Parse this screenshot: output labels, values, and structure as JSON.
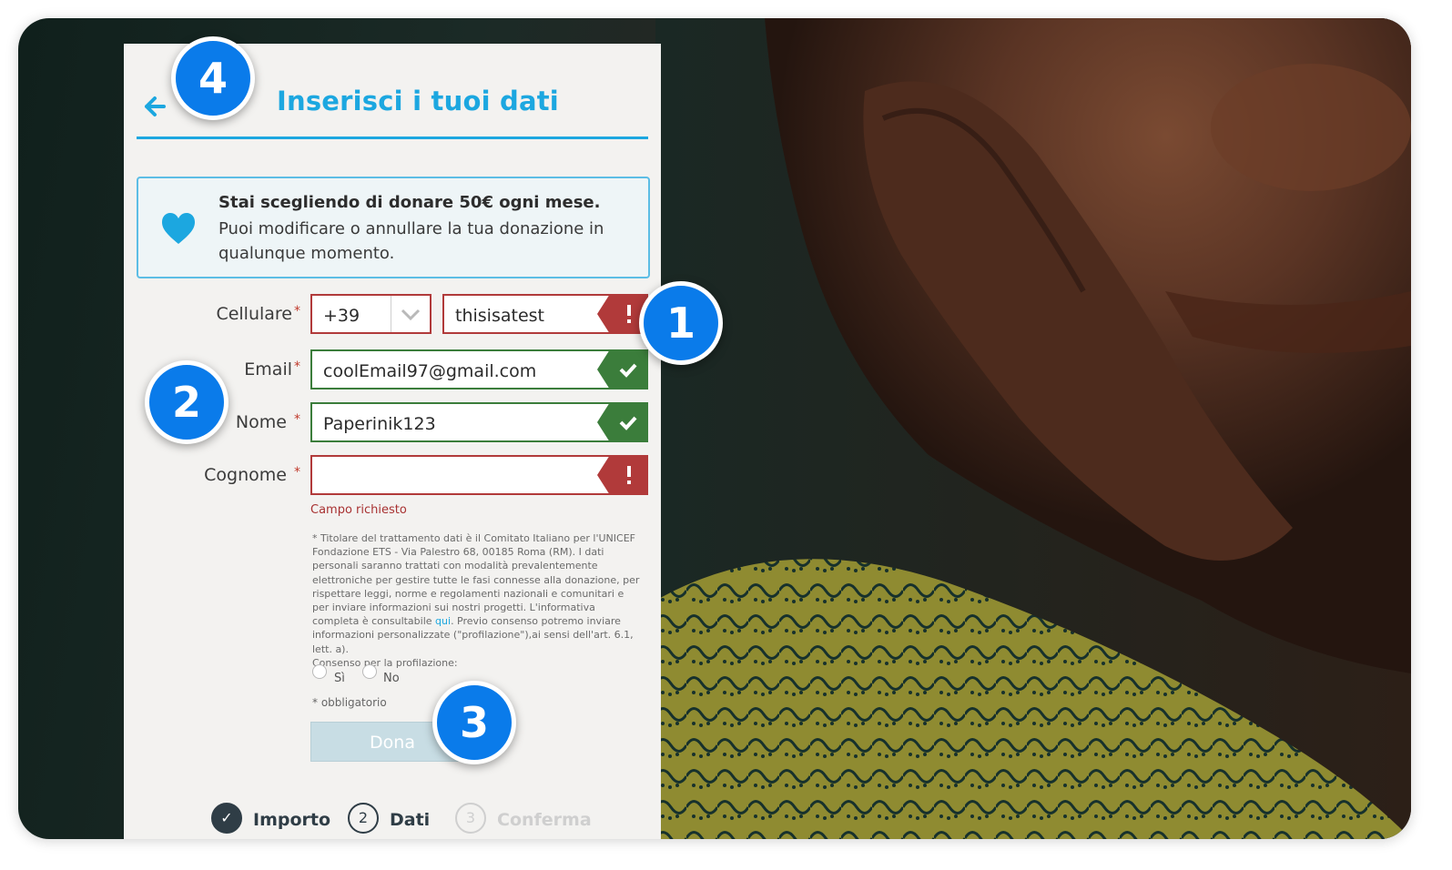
{
  "header": {
    "title": "Inserisci i tuoi dati"
  },
  "info": {
    "bold": "Stai scegliendo di donare 50€ ogni mese.",
    "text": "Puoi modificare o annullare la tua donazione in qualunque momento."
  },
  "form": {
    "cellulare": {
      "label": "Cellulare",
      "prefix": "+39",
      "value": "thisisatest",
      "status": "error"
    },
    "email": {
      "label": "Email",
      "value": "coolEmail97@gmail.com",
      "status": "valid"
    },
    "nome": {
      "label": "Nome",
      "value": "Paperinik123",
      "status": "valid"
    },
    "cognome": {
      "label": "Cognome",
      "value": "",
      "status": "error",
      "error": "Campo richiesto"
    },
    "required_mark": "*"
  },
  "legal": {
    "text_before_link": "* Titolare del trattamento dati è il Comitato Italiano per l'UNICEF Fondazione ETS - Via Palestro 68, 00185 Roma (RM). I dati personali saranno trattati con modalità prevalentemente elettroniche per gestire tutte le fasi connesse alla donazione, per rispettare leggi, norme e regolamenti nazionali e comunitari e per inviare informazioni sui nostri progetti. L'informativa completa è consultabile",
    "link": "qui",
    "text_after_link": ". Previo consenso potremo inviare informazioni personalizzate (\"profilazione\"),ai sensi dell'art. 6.1, lett. a).",
    "consent": "Consenso per la profilazione:",
    "yes": "Sì",
    "no": "No",
    "mandatory": "* obbligatorio"
  },
  "submit": {
    "label": "Dona"
  },
  "steps": [
    {
      "number": "✓",
      "label": "Importo",
      "state": "done"
    },
    {
      "number": "2",
      "label": "Dati",
      "state": "current"
    },
    {
      "number": "3",
      "label": "Conferma",
      "state": "upcoming"
    }
  ],
  "callouts": [
    "1",
    "2",
    "3",
    "4"
  ],
  "colors": {
    "accent": "#1ca7e0",
    "error": "#b13a3a",
    "valid": "#3b7d3b",
    "callout": "#0a7bea"
  }
}
